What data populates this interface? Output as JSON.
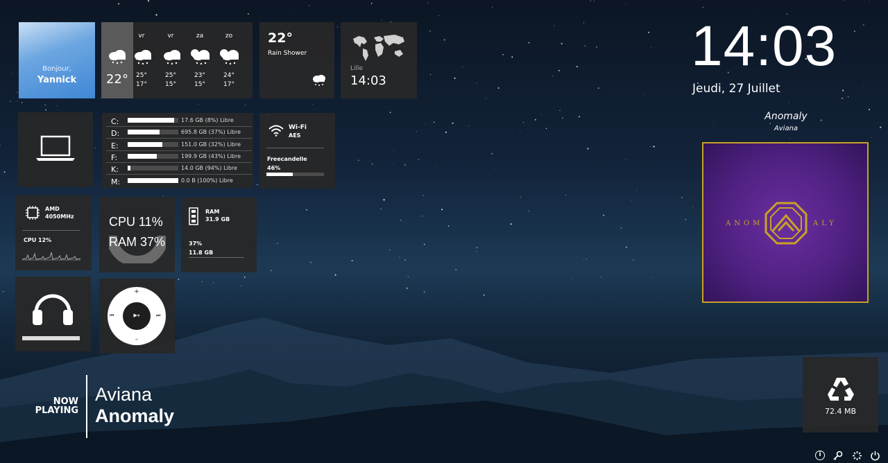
{
  "greeting": {
    "line1": "Bonjour,",
    "name": "Yannick"
  },
  "weather": {
    "current_temp": "22°",
    "forecast": [
      {
        "day": "vr",
        "high": "25°",
        "low": "17°"
      },
      {
        "day": "vr",
        "high": "25°",
        "low": "15°"
      },
      {
        "day": "za",
        "high": "23°",
        "low": "15°"
      },
      {
        "day": "zo",
        "high": "24°",
        "low": "17°"
      }
    ],
    "now": {
      "temp": "22°",
      "desc": "Rain Shower"
    }
  },
  "world_clock": {
    "city": "Lille",
    "time": "14:03"
  },
  "clock": {
    "time": "14:03",
    "date": "Jeudi, 27 Juillet"
  },
  "drives": [
    {
      "letter": "C:",
      "text": "17.6 GB (8%) Libre",
      "used": 0.92
    },
    {
      "letter": "D:",
      "text": "695.8 GB (37%) Libre",
      "used": 0.63
    },
    {
      "letter": "E:",
      "text": "151.0 GB (32%) Libre",
      "used": 0.68
    },
    {
      "letter": "F:",
      "text": "199.9 GB (43%) Libre",
      "used": 0.57
    },
    {
      "letter": "K:",
      "text": "14.0 GB (94%) Libre",
      "used": 0.06
    },
    {
      "letter": "M:",
      "text": "0.0 B (100%) Libre",
      "used": 1.0
    }
  ],
  "wifi": {
    "label": "Wi-Fi",
    "ssid": "AES",
    "network": "Freecandelle",
    "strength": "46%",
    "strength_value": 0.46
  },
  "cpu_tile": {
    "brand": "AMD",
    "freq": "4050MHz",
    "usage": "CPU 12%"
  },
  "gauge": {
    "cpu": "CPU 11%",
    "ram": "RAM 37%"
  },
  "ram_tile": {
    "label": "RAM",
    "total": "31.9 GB",
    "percent": "37%",
    "used": "11.8 GB",
    "fill": 0.37
  },
  "player_controls": {
    "plus": "+",
    "minus": "–",
    "prev": "⏮",
    "next": "⏭",
    "play": "▶⏸"
  },
  "now_playing": {
    "label1": "NOW",
    "label2": "PLAYING",
    "artist": "Aviana",
    "title": "Anomaly"
  },
  "album": {
    "title": "Anomaly",
    "artist": "Aviana",
    "cover_text_left": "ANOM",
    "cover_text_right": "ALY"
  },
  "recycle": {
    "size": "72.4 MB"
  },
  "colors": {
    "tile": "#282828",
    "album_purple": "#5a2a8a",
    "album_gold": "#c9a227"
  },
  "system_icons": [
    "info-icon",
    "settings-key-icon",
    "loading-icon",
    "power-icon"
  ]
}
